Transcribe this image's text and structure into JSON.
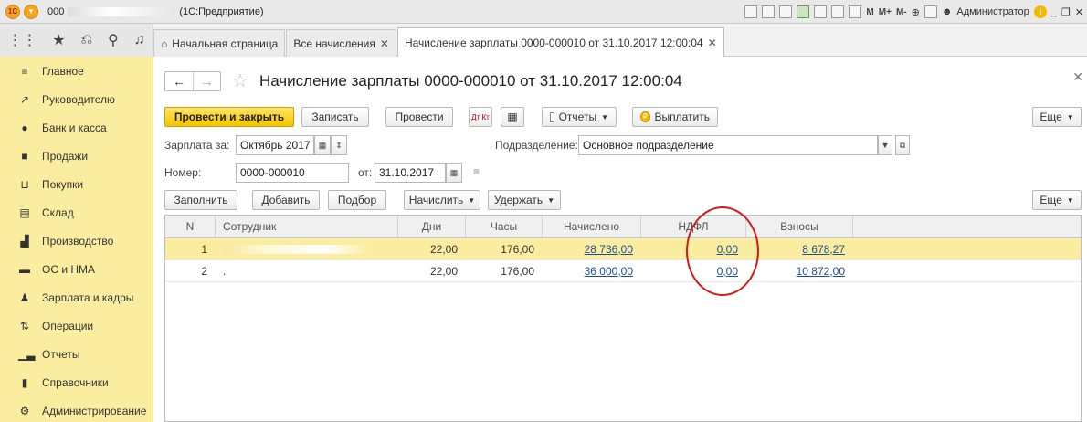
{
  "window": {
    "title_prefix": "000",
    "title_suffix": "(1С:Предприятие)",
    "toolbar_items": [
      "M",
      "M+",
      "M-"
    ],
    "user": "Администратор"
  },
  "tabs": [
    {
      "label": "Начальная страница",
      "closable": false
    },
    {
      "label": "Все начисления",
      "closable": true
    },
    {
      "label": "Начисление зарплаты 0000-000010 от 31.10.2017 12:00:04",
      "closable": true
    }
  ],
  "sidebar": {
    "items": [
      {
        "label": "Главное",
        "icon": "menu-lines-icon"
      },
      {
        "label": "Руководителю",
        "icon": "trend-icon"
      },
      {
        "label": "Банк и касса",
        "icon": "coin-icon"
      },
      {
        "label": "Продажи",
        "icon": "bag-icon"
      },
      {
        "label": "Покупки",
        "icon": "cart-icon"
      },
      {
        "label": "Склад",
        "icon": "warehouse-icon"
      },
      {
        "label": "Производство",
        "icon": "factory-icon"
      },
      {
        "label": "ОС и НМА",
        "icon": "truck-icon"
      },
      {
        "label": "Зарплата и кадры",
        "icon": "person-icon"
      },
      {
        "label": "Операции",
        "icon": "operations-icon"
      },
      {
        "label": "Отчеты",
        "icon": "bar-chart-icon"
      },
      {
        "label": "Справочники",
        "icon": "book-icon"
      },
      {
        "label": "Администрирование",
        "icon": "gear-icon"
      }
    ]
  },
  "document": {
    "title": "Начисление зарплаты 0000-000010 от 31.10.2017 12:00:04",
    "buttons": {
      "post_close": "Провести и закрыть",
      "save": "Записать",
      "post": "Провести",
      "dtkt": "Дт Кт",
      "reports": "Отчеты",
      "pay": "Выплатить",
      "more": "Еще"
    },
    "fields": {
      "salary_for_label": "Зарплата за:",
      "salary_for_value": "Октябрь 2017",
      "department_label": "Подразделение:",
      "department_value": "Основное подразделение",
      "number_label": "Номер:",
      "number_value": "0000-000010",
      "date_label": "от:",
      "date_value": "31.10.2017"
    },
    "table_buttons": {
      "fill": "Заполнить",
      "add": "Добавить",
      "select": "Подбор",
      "accrue": "Начислить",
      "withhold": "Удержать",
      "more": "Еще"
    }
  },
  "table": {
    "headers": [
      "N",
      "Сотрудник",
      "Дни",
      "Часы",
      "Начислено",
      "НДФЛ",
      "Взносы"
    ],
    "rows": [
      {
        "n": "1",
        "employee": "",
        "days": "22,00",
        "hours": "176,00",
        "accrued": "28 736,00",
        "ndfl": "0,00",
        "contributions": "8 678,27",
        "selected": true
      },
      {
        "n": "2",
        "employee": ".",
        "days": "22,00",
        "hours": "176,00",
        "accrued": "36 000,00",
        "ndfl": "0,00",
        "contributions": "10 872,00",
        "selected": false
      }
    ]
  },
  "colors": {
    "sidebar_bg": "#fbeda0",
    "primary_button": "#f4c500",
    "link": "#1f4e9a",
    "annotation_circle": "#d01a1a"
  }
}
